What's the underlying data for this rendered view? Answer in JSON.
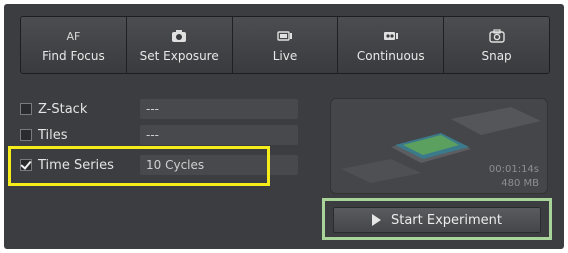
{
  "toolbar": {
    "buttons": [
      {
        "label": "Find Focus",
        "icon_text": "AF",
        "icon": "af-icon"
      },
      {
        "label": "Set Exposure",
        "icon": "camera-icon"
      },
      {
        "label": "Live",
        "icon": "live-camera-icon"
      },
      {
        "label": "Continuous",
        "icon": "continuous-camera-icon"
      },
      {
        "label": "Snap",
        "icon": "snap-camera-icon"
      }
    ]
  },
  "options": [
    {
      "label": "Z-Stack",
      "value": "---",
      "checked": false
    },
    {
      "label": "Tiles",
      "value": "---",
      "checked": false
    },
    {
      "label": "Time Series",
      "value": "10 Cycles",
      "checked": true
    }
  ],
  "preview": {
    "duration": "00:01:14s",
    "size": "480 MB"
  },
  "start_button": {
    "label": "Start Experiment"
  },
  "colors": {
    "panel": "#3c3d40",
    "highlight_yellow": "#f5ec1a",
    "highlight_green": "#a8d49a"
  }
}
